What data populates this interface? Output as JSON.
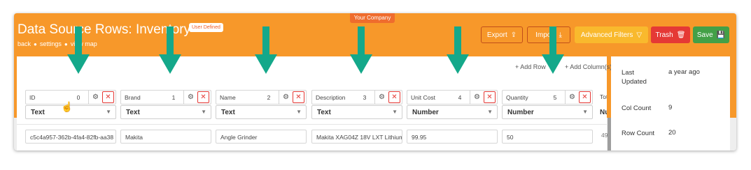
{
  "company": "Your Company",
  "page": {
    "title": "Data Source Rows: Inventory",
    "badge": "User Defined"
  },
  "breadcrumbs": [
    "back",
    "settings",
    "view map"
  ],
  "toolbar": {
    "export": "Export",
    "import": "Import",
    "advanced_filters": "Advanced Filters",
    "trash": "Trash",
    "save": "Save"
  },
  "actions": {
    "add_row": "+ Add Row",
    "add_column": "+ Add Column(s)"
  },
  "columns": [
    {
      "name": "ID",
      "index": "0",
      "type": "Text"
    },
    {
      "name": "Brand",
      "index": "1",
      "type": "Text"
    },
    {
      "name": "Name",
      "index": "2",
      "type": "Text"
    },
    {
      "name": "Description",
      "index": "3",
      "type": "Text"
    },
    {
      "name": "Unit Cost",
      "index": "4",
      "type": "Number"
    },
    {
      "name": "Quantity",
      "index": "5",
      "type": "Number"
    }
  ],
  "partial_column": {
    "name": "Tot",
    "type": "Nu",
    "cell": "49"
  },
  "rows": [
    [
      "c5c4a957-362b-4fa4-82fb-aa38",
      "Makita",
      "Angle Grinder",
      "Makita XAG04Z 18V LXT Lithium",
      "99.95",
      "50"
    ]
  ],
  "info": [
    {
      "label": "Last Updated",
      "value": "a year ago"
    },
    {
      "label": "Col Count",
      "value": "9"
    },
    {
      "label": "Row Count",
      "value": "20"
    }
  ],
  "colors": {
    "banner": "#f7982a",
    "arrow": "#14a88a",
    "trash": "#e53935",
    "save": "#43a047",
    "filters": "#f9b92d"
  }
}
